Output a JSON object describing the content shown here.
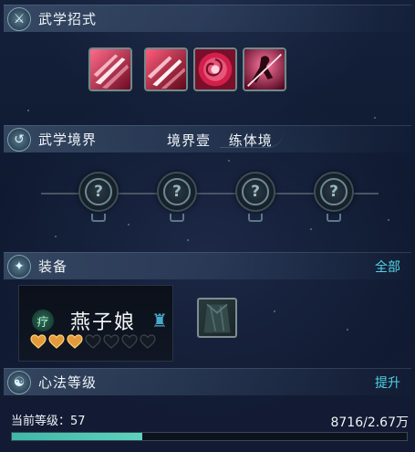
{
  "sections": {
    "skills": {
      "title": "武学招式",
      "icon": "sword-icon"
    },
    "realm": {
      "title": "武学境界",
      "icon": "swirl-icon",
      "realm_level": "境界壹",
      "realm_name": "练体境"
    },
    "equipment": {
      "title": "装备",
      "icon": "armor-icon",
      "action": "全部"
    },
    "heart_method": {
      "title": "心法等级",
      "icon": "meditation-icon",
      "action": "提升"
    }
  },
  "skills": [
    {
      "icon": "slash-skill-icon",
      "color": "#d8234a"
    },
    {
      "icon": "slash-skill-icon",
      "color": "#d8234a"
    },
    {
      "icon": "rose-seal-skill-icon",
      "color": "#c02048"
    },
    {
      "icon": "blade-dance-skill-icon",
      "color": "#b81a56"
    }
  ],
  "realm_nodes": [
    {
      "icon": "locked-node-icon",
      "state": "locked"
    },
    {
      "icon": "locked-node-icon",
      "state": "locked"
    },
    {
      "icon": "locked-node-icon",
      "state": "locked"
    },
    {
      "icon": "locked-node-icon",
      "state": "locked"
    }
  ],
  "equipment": {
    "badge": "疗",
    "name": "燕子娘",
    "emblem_icon": "owl-emblem-icon",
    "hearts_filled": 3,
    "hearts_total": 7,
    "heart_color": "#e39a3a",
    "slot_icon": "cloak-icon"
  },
  "level": {
    "label": "当前等级：57",
    "value": 57,
    "exp_text": "8716/2.67万",
    "progress": 0.33
  },
  "colors": {
    "accent": "#4fd4e6",
    "progress": "#4cc4b2"
  }
}
